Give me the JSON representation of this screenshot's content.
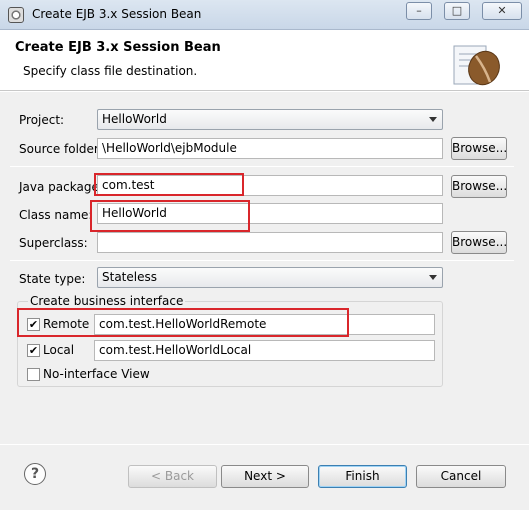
{
  "window": {
    "title": "Create EJB 3.x Session Bean",
    "minimize_label": "–",
    "maximize_label": "□",
    "close_label": "✕"
  },
  "header": {
    "title": "Create EJB 3.x Session Bean",
    "subtitle": "Specify class file destination."
  },
  "form": {
    "project_label": "Project:",
    "project_value": "HelloWorld",
    "source_folder_label": "Source folder:",
    "source_folder_value": "\\HelloWorld\\ejbModule",
    "java_package_label": "Java package:",
    "java_package_value": "com.test",
    "class_name_label": "Class name:",
    "class_name_value": "HelloWorld",
    "superclass_label": "Superclass:",
    "superclass_value": "",
    "browse_label": "Browse...",
    "state_type_label": "State type:",
    "state_type_value": "Stateless"
  },
  "business_interface": {
    "group_label": "Create business interface",
    "remote_label": "Remote",
    "remote_checked": true,
    "remote_value": "com.test.HelloWorldRemote",
    "local_label": "Local",
    "local_checked": true,
    "local_value": "com.test.HelloWorldLocal",
    "no_interface_label": "No-interface View",
    "no_interface_checked": false
  },
  "footer": {
    "help_icon": "question-mark-icon",
    "back_label": "< Back",
    "next_label": "Next >",
    "finish_label": "Finish",
    "cancel_label": "Cancel"
  },
  "colors": {
    "highlight_box": "#d9262b",
    "dialog_bg": "#f0f0f0"
  }
}
